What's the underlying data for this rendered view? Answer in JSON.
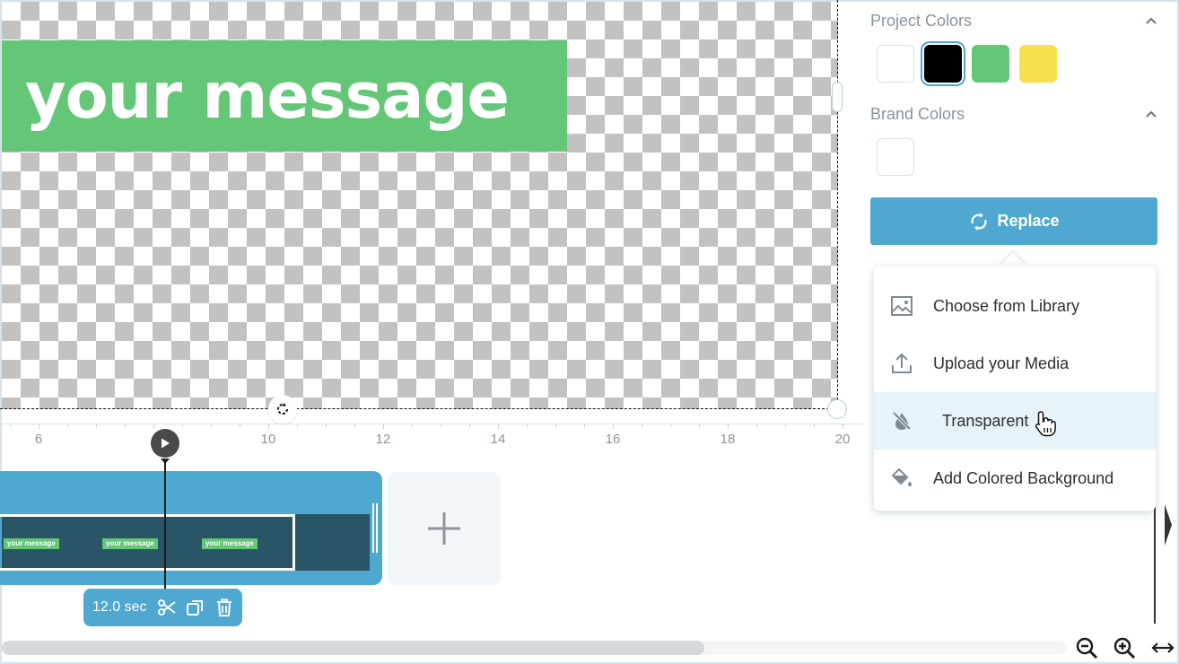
{
  "canvas": {
    "text_element": "your message",
    "text_bg_color": "#64c778",
    "checker_color": "#c2c2c2"
  },
  "ruler": {
    "unit_start": 5.35,
    "unit_end": 20.3,
    "labels": [
      "6",
      "10",
      "12",
      "14",
      "16",
      "18",
      "20"
    ]
  },
  "playhead": {
    "position_seconds": 8.2,
    "play_icon": "play-icon"
  },
  "clip": {
    "thumbnail_label": "your message",
    "duration": "12.0 sec",
    "color": "#4fa8cf",
    "strip_color": "#2a5567",
    "toolbar_icons": [
      "scissors-icon",
      "duplicate-icon",
      "trash-icon"
    ]
  },
  "add_clip": {
    "icon": "plus-icon"
  },
  "scrollbar": {
    "visible_fraction": 0.66
  },
  "zoom_controls": [
    "zoom-out-icon",
    "zoom-in-icon",
    "fit-width-icon"
  ],
  "panel": {
    "project_colors": {
      "title": "Project Colors",
      "swatches": [
        "#ffffff",
        "#000000",
        "#64c778",
        "#f8df4c"
      ],
      "selected_index": 1
    },
    "brand_colors": {
      "title": "Brand Colors",
      "swatches": [
        "#ffffff"
      ]
    },
    "replace_button": "Replace"
  },
  "replace_menu": {
    "items": [
      {
        "label": "Choose from Library",
        "icon": "image-icon"
      },
      {
        "label": "Upload your Media",
        "icon": "upload-icon"
      },
      {
        "label": "Transparent",
        "icon": "no-fill-icon",
        "hovered": true
      },
      {
        "label": "Add Colored Background",
        "icon": "paint-bucket-icon"
      }
    ]
  }
}
